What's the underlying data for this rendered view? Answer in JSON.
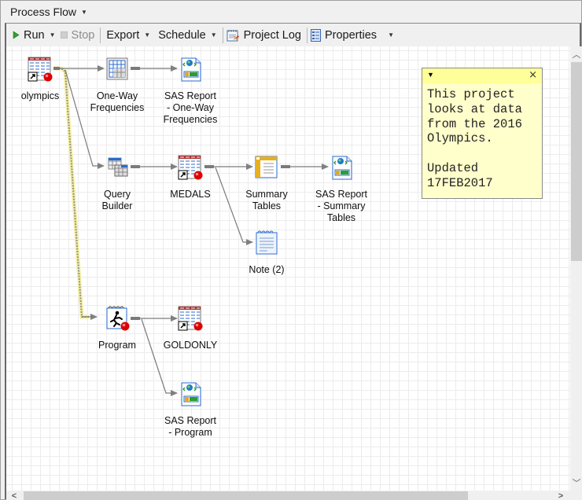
{
  "window": {
    "title": "Process Flow",
    "title_dropdown_icon": "caret-down-icon"
  },
  "toolbar": {
    "run_label": "Run",
    "stop_label": "Stop",
    "export_label": "Export",
    "schedule_label": "Schedule",
    "project_log_label": "Project Log",
    "properties_label": "Properties"
  },
  "nodes": {
    "olympics": {
      "label": "olympics",
      "icon": "data-table-shortcut-icon"
    },
    "one_way_freq": {
      "label": "One-Way Frequencies",
      "line1": "One-Way",
      "line2": "Frequencies",
      "icon": "frequency-table-icon"
    },
    "sas_report_oneway": {
      "line1": "SAS Report",
      "line2": "- One-Way",
      "line3": "Frequencies",
      "icon": "sas-report-icon"
    },
    "query_builder": {
      "line1": "Query",
      "line2": "Builder",
      "icon": "query-builder-icon"
    },
    "medals": {
      "label": "MEDALS",
      "icon": "data-table-shortcut-icon"
    },
    "summary_tables": {
      "line1": "Summary",
      "line2": "Tables",
      "icon": "summary-tables-icon"
    },
    "sas_report_summary": {
      "line1": "SAS Report",
      "line2": "- Summary",
      "line3": "Tables",
      "icon": "sas-report-icon"
    },
    "note2": {
      "label": "Note (2)",
      "icon": "note-icon"
    },
    "program": {
      "label": "Program",
      "icon": "sas-program-icon"
    },
    "goldonly": {
      "label": "GOLDONLY",
      "icon": "data-table-shortcut-icon"
    },
    "sas_report_program": {
      "line1": "SAS Report",
      "line2": "- Program",
      "icon": "sas-report-icon"
    }
  },
  "note": {
    "text": "This project\nlooks at data\nfrom the 2016\nOlympics.\n\nUpdated\n17FEB2017",
    "close_glyph": "×",
    "menu_glyph": "▾"
  },
  "links": [
    [
      "olympics",
      "one_way_freq"
    ],
    [
      "one_way_freq",
      "sas_report_oneway"
    ],
    [
      "olympics",
      "query_builder"
    ],
    [
      "olympics",
      "program",
      "selected"
    ],
    [
      "query_builder",
      "medals"
    ],
    [
      "medals",
      "summary_tables"
    ],
    [
      "medals",
      "note2"
    ],
    [
      "summary_tables",
      "sas_report_summary"
    ],
    [
      "program",
      "goldonly"
    ],
    [
      "program",
      "sas_report_program"
    ]
  ],
  "colors": {
    "run_green": "#2ea02e",
    "selected_link": "#f5f0a0",
    "link_gray": "#7a7a7a",
    "note_bg": "#ffffcc",
    "note_header": "#ffff99"
  }
}
